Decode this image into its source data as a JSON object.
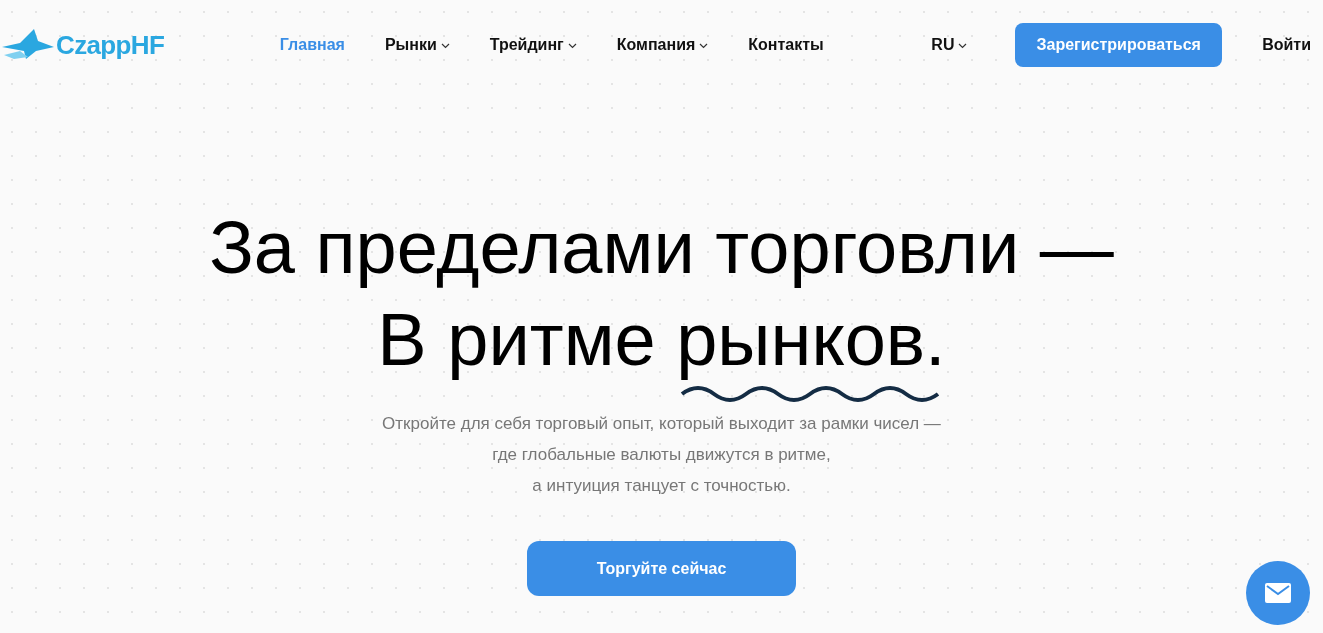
{
  "header": {
    "logo": "CzappHF",
    "nav": [
      {
        "label": "Главная",
        "selected": true,
        "dropdown": false
      },
      {
        "label": "Рынки",
        "selected": false,
        "dropdown": true
      },
      {
        "label": "Трейдинг",
        "selected": false,
        "dropdown": true
      },
      {
        "label": "Компания",
        "selected": false,
        "dropdown": true
      },
      {
        "label": "Контакты",
        "selected": false,
        "dropdown": false
      }
    ],
    "language": "RU",
    "register": "Зарегистрироваться",
    "login": "Войти"
  },
  "hero": {
    "title_line_1": "За пределами торговли —",
    "title_line_2_start": "В ритме ",
    "title_line_2_underlined": "рынков.",
    "subtitle": [
      "Откройте для себя торговый опыт, который выходит за рамки чисел —",
      "где глобальные валюты движутся в ритме,",
      "а интуиция танцует с точностью."
    ],
    "cta": "Торгуйте сейчас"
  }
}
